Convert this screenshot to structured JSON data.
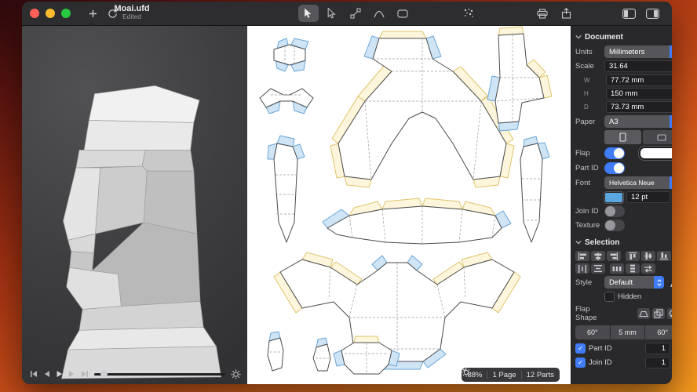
{
  "window": {
    "title": "Moai.ufd",
    "status": "Edited"
  },
  "toolbar_icons": [
    "plus",
    "sync",
    "select-tool",
    "select-alt-tool",
    "node-tool",
    "arc-tool",
    "shape-tool",
    "magic-tool",
    "print",
    "share",
    "toggle-left-panel",
    "toggle-right-panel"
  ],
  "viewport_controls": [
    "skip-start",
    "step-back",
    "play",
    "step-forward",
    "skip-end",
    "timeline-slider",
    "settings"
  ],
  "canvas": {
    "zoom": "88%",
    "pages": "1 Page",
    "parts": "12 Parts"
  },
  "sidebar": {
    "document": {
      "title": "Document",
      "units_label": "Units",
      "units_value": "Millimeters",
      "scale_label": "Scale",
      "scale_value": "31.64",
      "dims": [
        {
          "label": "W",
          "value": "77.72 mm"
        },
        {
          "label": "H",
          "value": "150 mm"
        },
        {
          "label": "D",
          "value": "73.73 mm"
        }
      ],
      "paper_label": "Paper",
      "paper_value": "A3",
      "flap_label": "Flap",
      "part_id_label": "Part ID",
      "font_label": "Font",
      "font_value": "Helvetica Neue",
      "font_size": "12 pt",
      "join_id_label": "Join ID",
      "texture_label": "Texture"
    },
    "selection": {
      "title": "Selection",
      "style_label": "Style",
      "style_value": "Default",
      "hidden_label": "Hidden",
      "flap_shape_label": "Flap Shape",
      "flap_segments": [
        "60°",
        "5 mm",
        "60°"
      ],
      "part_id_label": "Part ID",
      "part_id_value": "1",
      "join_id_label": "Join ID",
      "join_id_value": "1"
    }
  },
  "colors": {
    "accent": "#3f7cf6",
    "flap_blue_fill": "#cfe4f4",
    "flap_blue_stroke": "#6aa5d8",
    "flap_yellow_fill": "#fdf6dc",
    "flap_yellow_stroke": "#e0c36a",
    "flap_color_swatch": "#ffffff",
    "font_color_swatch": "#5aa7e0"
  }
}
